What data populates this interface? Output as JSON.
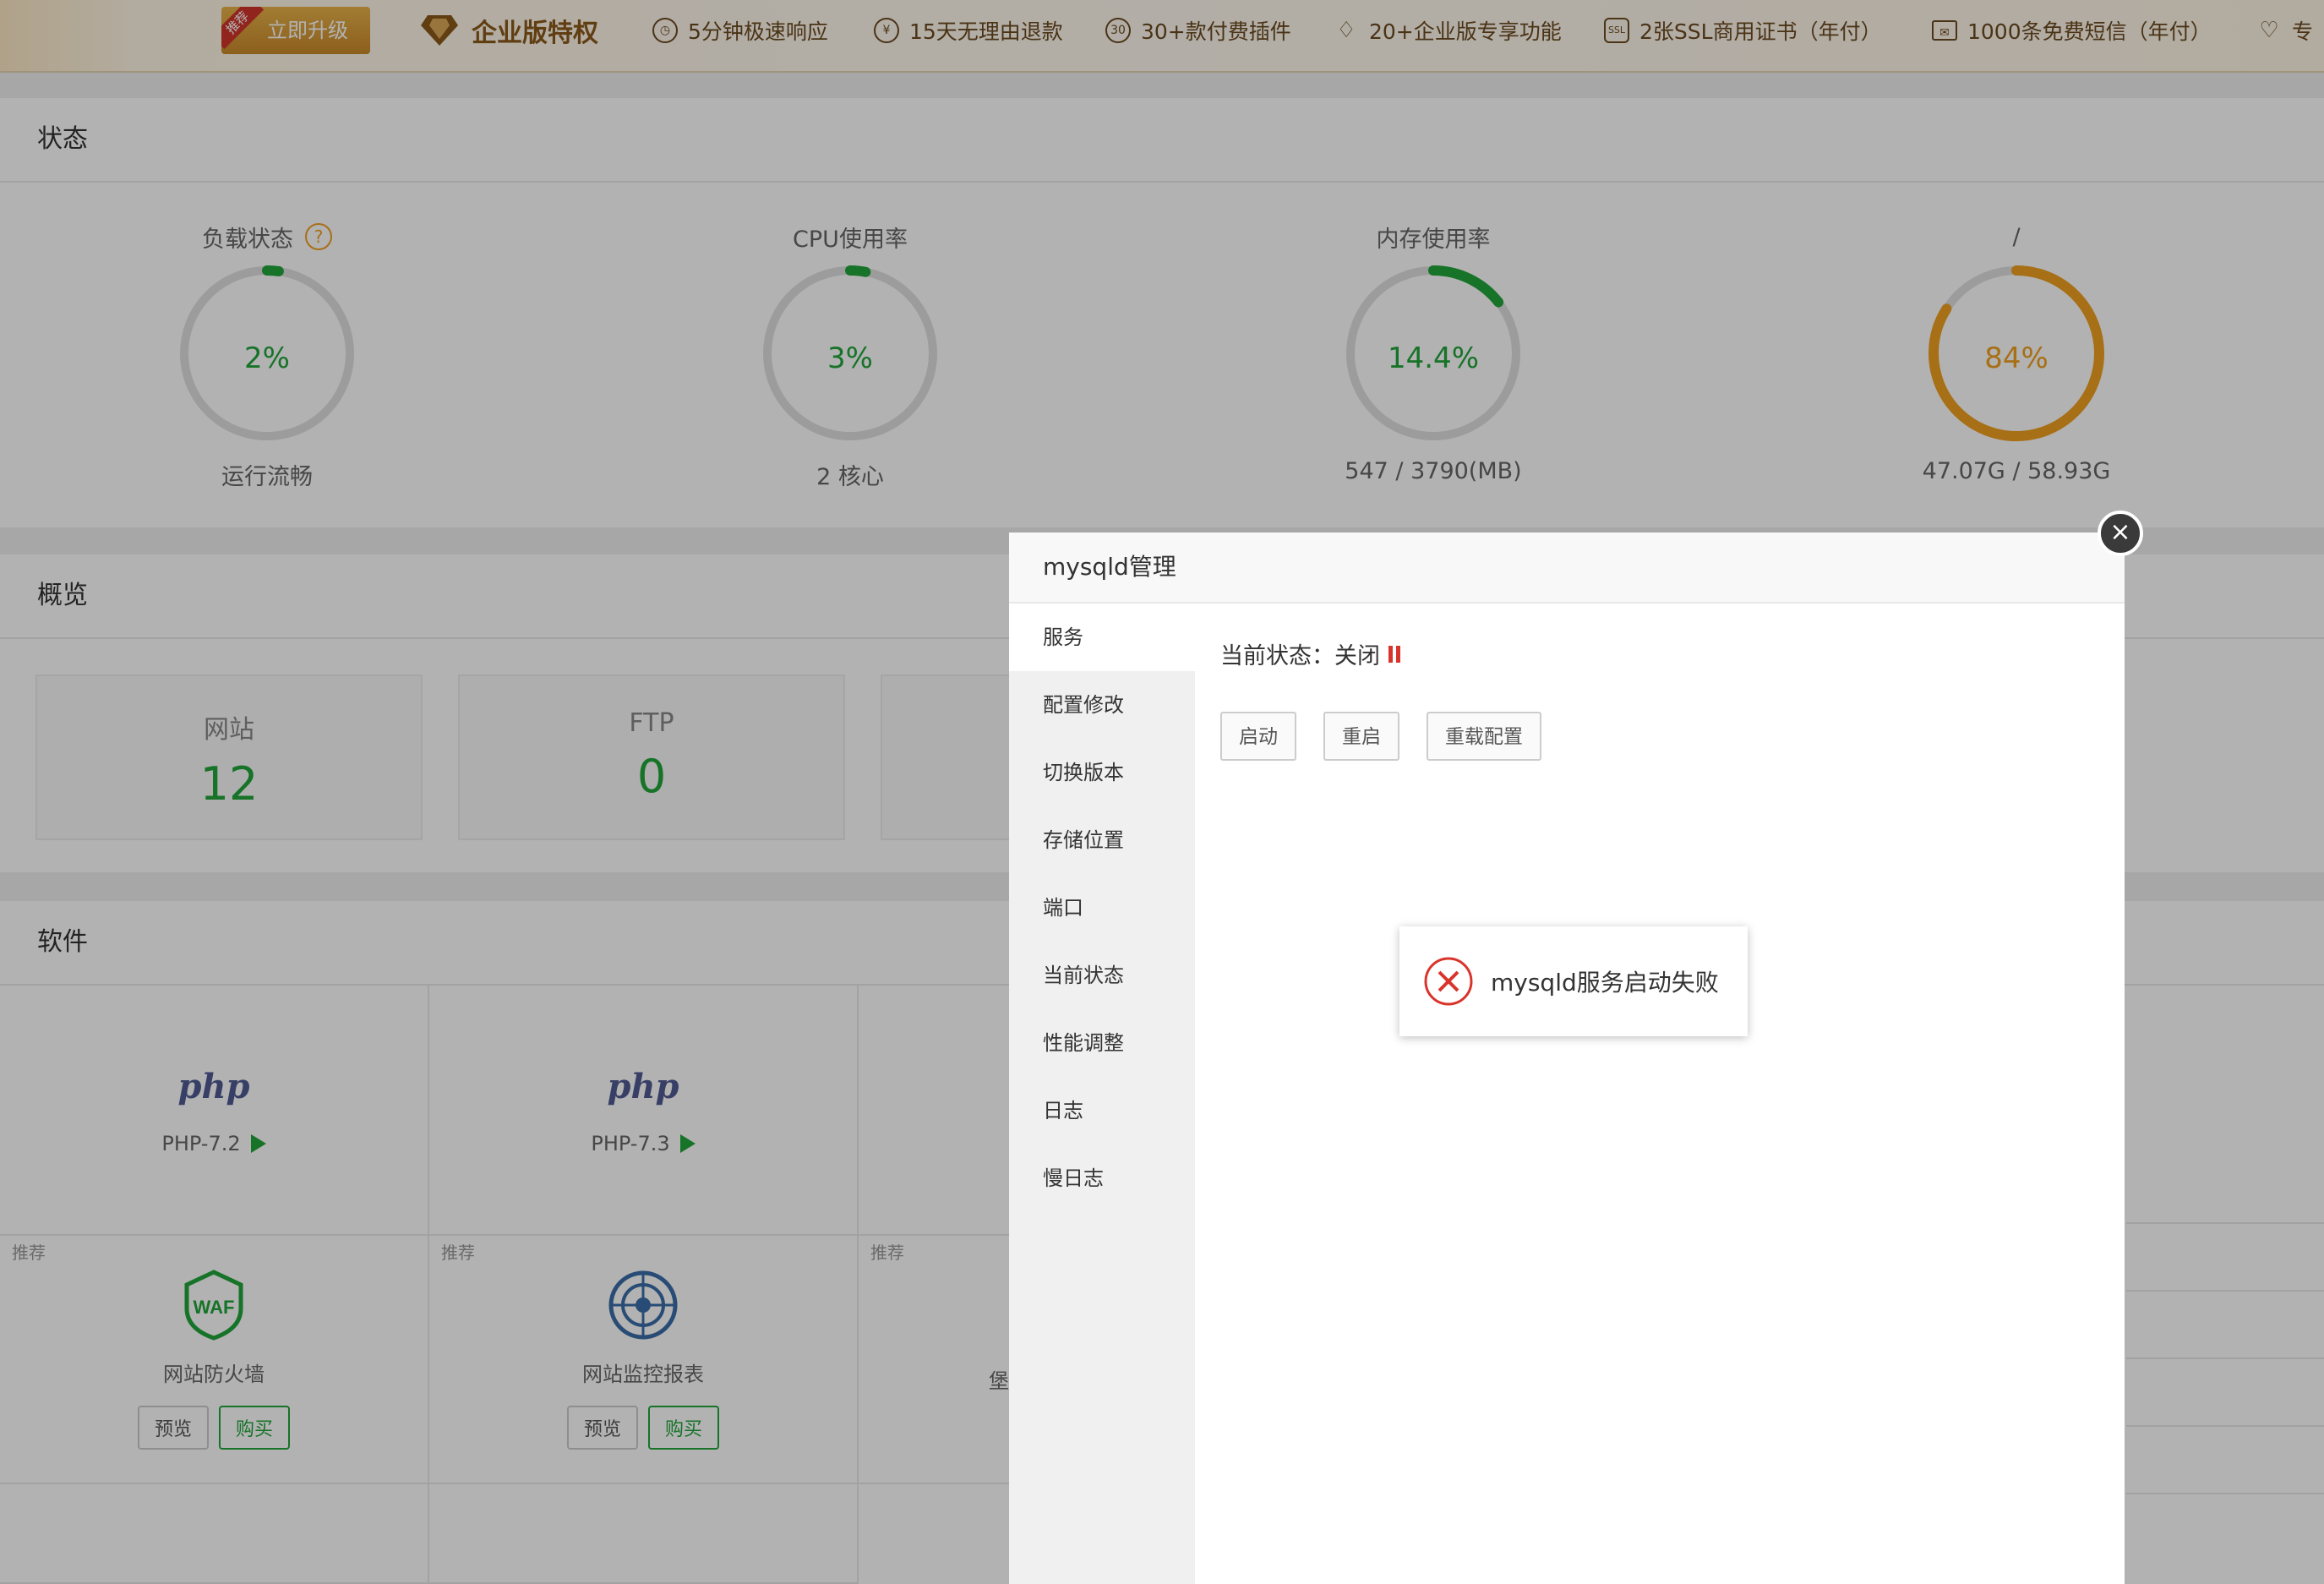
{
  "topbar": {
    "badge": "推荐",
    "upgrade_label": "立即升级",
    "enterprise_title": "企业版特权",
    "perks": [
      {
        "icon": "clock-icon",
        "label": "5分钟极速响应"
      },
      {
        "icon": "refund-icon",
        "label": "15天无理由退款"
      },
      {
        "icon": "plugin-icon",
        "label": "30+款付费插件"
      },
      {
        "icon": "diamond-icon",
        "label": "20+企业版专享功能"
      },
      {
        "icon": "ssl-shield-icon",
        "label": "2张SSL商用证书（年付）"
      },
      {
        "icon": "mail-icon",
        "label": "1000条免费短信（年付）"
      },
      {
        "icon": "heart-icon",
        "label": "专"
      }
    ]
  },
  "status": {
    "title": "状态",
    "gauges": [
      {
        "title": "负载状态",
        "value": "2%",
        "sub": "运行流畅",
        "percent": 2,
        "color": "#20a53a",
        "help": "?"
      },
      {
        "title": "CPU使用率",
        "value": "3%",
        "sub": "2 核心",
        "percent": 3,
        "color": "#20a53a"
      },
      {
        "title": "内存使用率",
        "value": "14.4%",
        "sub": "547 / 3790(MB)",
        "percent": 14.4,
        "color": "#20a53a"
      },
      {
        "title": "/",
        "value": "84%",
        "sub": "47.07G / 58.93G",
        "percent": 84,
        "color": "#f0a020"
      }
    ]
  },
  "overview": {
    "title": "概览",
    "cards": [
      {
        "label": "网站",
        "value": "12"
      },
      {
        "label": "FTP",
        "value": "0"
      }
    ]
  },
  "software": {
    "title": "软件",
    "php": [
      {
        "logo": "php",
        "name": "PHP-7.2"
      },
      {
        "logo": "php",
        "name": "PHP-7.3"
      }
    ],
    "plugins": [
      {
        "tag": "推荐",
        "icon_text": "WAF",
        "name": "网站防火墙",
        "preview": "预览",
        "buy": "购买"
      },
      {
        "tag": "推荐",
        "name": "网站监控报表",
        "preview": "预览",
        "buy": "购买"
      },
      {
        "tag": "推荐",
        "name": "堡"
      }
    ]
  },
  "modal": {
    "title": "mysqld管理",
    "close": "×",
    "menu": [
      "服务",
      "配置修改",
      "切换版本",
      "存储位置",
      "端口",
      "当前状态",
      "性能调整",
      "日志",
      "慢日志"
    ],
    "state_label": "当前状态：",
    "state_value": "关闭",
    "buttons": {
      "start": "启动",
      "restart": "重启",
      "reload": "重载配置"
    }
  },
  "toast": {
    "message": "mysqld服务启动失败"
  },
  "colors": {
    "green": "#20a53a",
    "orange": "#f0a020",
    "error_red": "#d9342b",
    "brand_gold": "#c9892a"
  }
}
